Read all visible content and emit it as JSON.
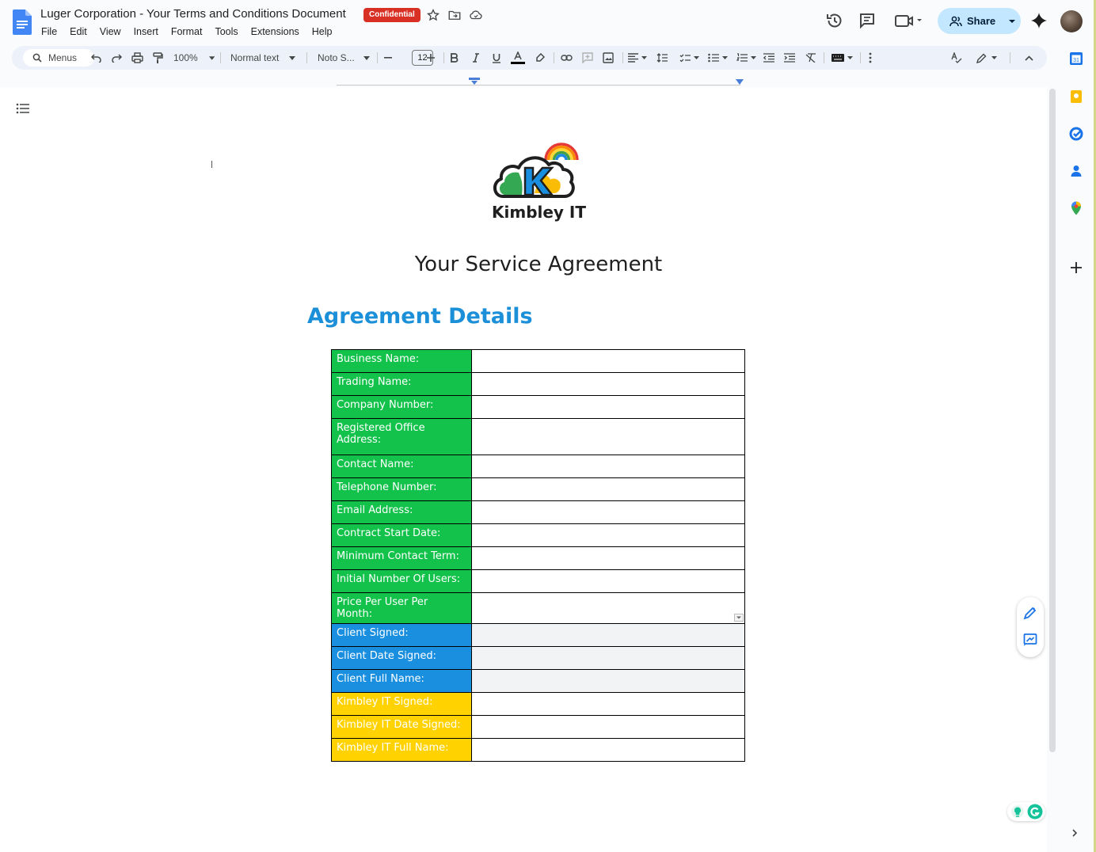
{
  "app": {
    "doc_title": "Luger Corporation - Your Terms and Conditions Document",
    "badge": "Confidential",
    "menu": [
      "File",
      "Edit",
      "View",
      "Insert",
      "Format",
      "Tools",
      "Extensions",
      "Help"
    ],
    "share_label": "Share"
  },
  "toolbar": {
    "search_label": "Menus",
    "zoom": "100%",
    "style": "Normal text",
    "font": "Noto S...",
    "font_size": "12"
  },
  "document": {
    "logo_text": "Kimbley IT",
    "heading": "Your Service Agreement",
    "subheading": "Agreement Details",
    "rows": [
      {
        "label": "Business Name:",
        "color": "green",
        "value": ""
      },
      {
        "label": "Trading Name:",
        "color": "green",
        "value": ""
      },
      {
        "label": "Company Number:",
        "color": "green",
        "value": ""
      },
      {
        "label": "Registered Office Address:",
        "color": "green",
        "value": ""
      },
      {
        "label": "Contact Name:",
        "color": "green",
        "value": ""
      },
      {
        "label": "Telephone Number:",
        "color": "green",
        "value": ""
      },
      {
        "label": "Email Address:",
        "color": "green",
        "value": ""
      },
      {
        "label": "Contract Start Date:",
        "color": "green",
        "value": ""
      },
      {
        "label": "Minimum Contact Term:",
        "color": "green",
        "value": ""
      },
      {
        "label": "Initial Number Of Users:",
        "color": "green",
        "value": ""
      },
      {
        "label": "Price Per User Per Month:",
        "color": "green",
        "value": ""
      },
      {
        "label": "Client Signed:",
        "color": "blue",
        "value": ""
      },
      {
        "label": "Client Date Signed:",
        "color": "blue",
        "value": ""
      },
      {
        "label": "Client Full Name:",
        "color": "blue",
        "value": ""
      },
      {
        "label": "Kimbley IT Signed:",
        "color": "yellow",
        "value": ""
      },
      {
        "label": "Kimbley IT Date Signed:",
        "color": "yellow",
        "value": ""
      },
      {
        "label": "Kimbley IT Full Name:",
        "color": "yellow",
        "value": ""
      }
    ]
  },
  "colors": {
    "green_label": "#12c24a",
    "blue_label": "#1a8fe0",
    "yellow_label": "#ffd200",
    "subheading": "#1b8fd8",
    "badge": "#d93025",
    "share_bg": "#c2e7ff"
  },
  "icons": [
    "docs-icon",
    "star-icon",
    "move-folder-icon",
    "cloud-saved-icon",
    "version-history-icon",
    "comments-icon",
    "meet-icon",
    "gemini-icon",
    "search-icon",
    "undo-icon",
    "redo-icon",
    "print-icon",
    "paint-format-icon",
    "bold-icon",
    "italic-icon",
    "underline-icon",
    "text-color-icon",
    "highlight-icon",
    "link-icon",
    "add-comment-icon",
    "image-icon",
    "align-icon",
    "line-spacing-icon",
    "checklist-icon",
    "bullet-list-icon",
    "numbered-list-icon",
    "indent-decrease-icon",
    "indent-increase-icon",
    "clear-format-icon",
    "input-tools-icon",
    "more-icon",
    "spellcheck-icon",
    "editing-mode-icon",
    "collapse-icon",
    "outline-icon",
    "calendar-icon",
    "keep-icon",
    "tasks-icon",
    "contacts-icon",
    "maps-icon",
    "add-icon",
    "edit-suggest-icon",
    "add-note-icon",
    "grammarly-icon"
  ]
}
